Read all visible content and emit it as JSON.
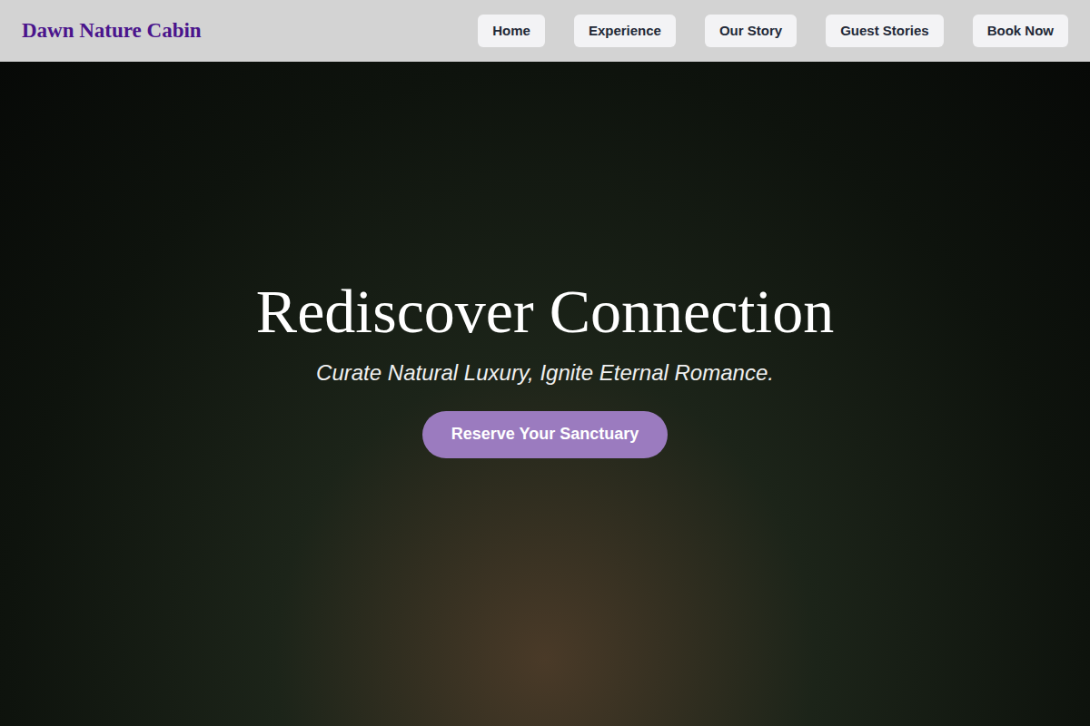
{
  "header": {
    "logo": "Dawn Nature Cabin",
    "nav": [
      {
        "label": "Home"
      },
      {
        "label": "Experience"
      },
      {
        "label": "Our Story"
      },
      {
        "label": "Guest Stories"
      },
      {
        "label": "Book Now"
      }
    ]
  },
  "hero": {
    "title": "Rediscover Connection",
    "subtitle": "Curate Natural Luxury, Ignite Eternal Romance.",
    "cta": "Reserve Your Sanctuary"
  }
}
